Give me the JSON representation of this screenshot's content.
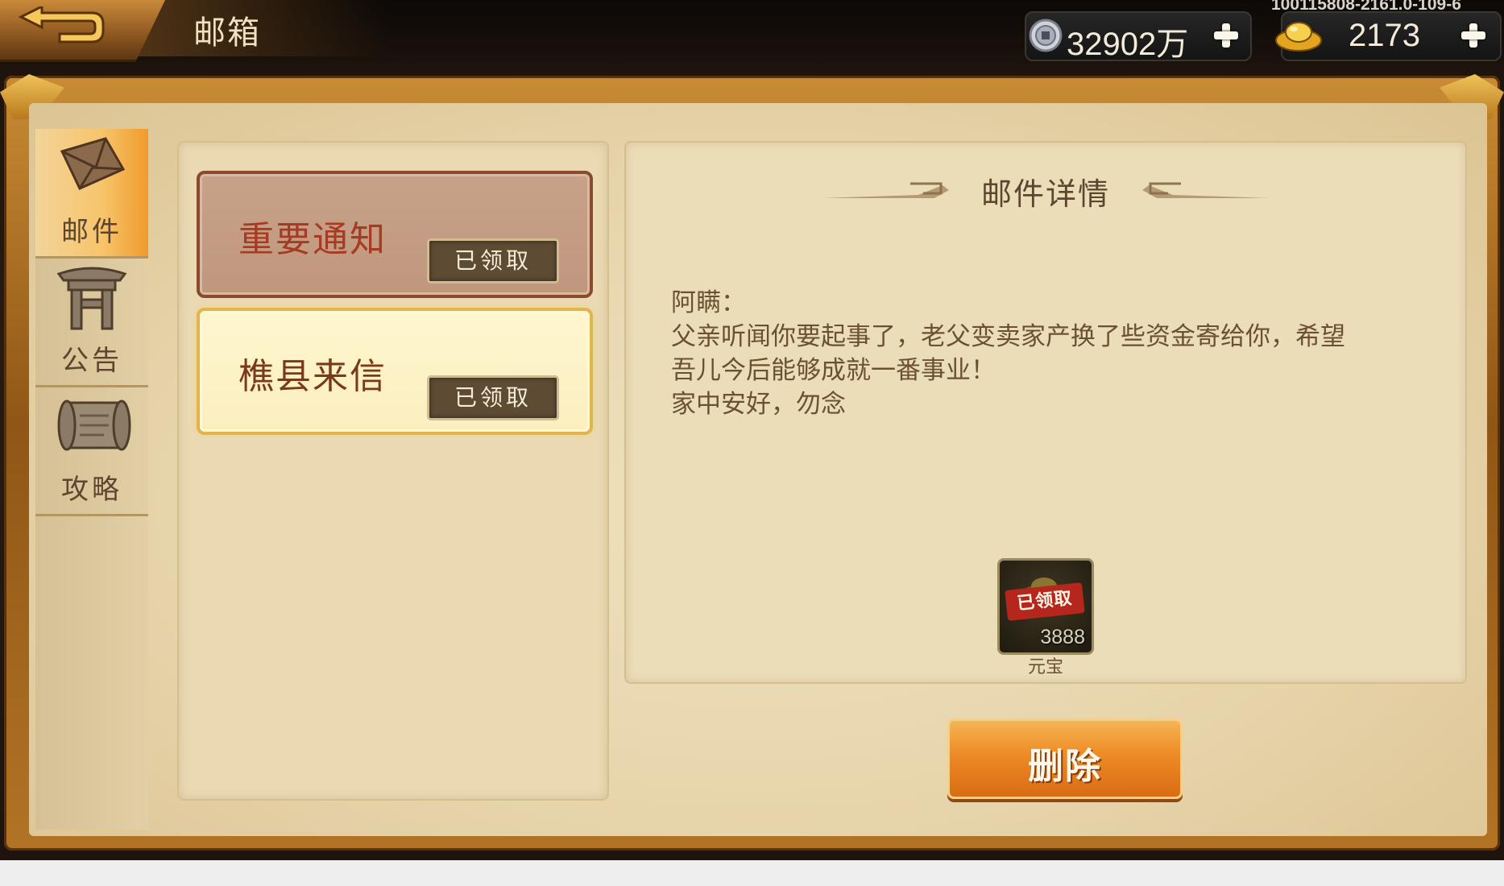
{
  "header": {
    "title": "邮箱",
    "version": "100115808-2161.0-109-6",
    "currencies": [
      {
        "name": "silver-coin",
        "amount": "32902万",
        "icon": "coin-icon"
      },
      {
        "name": "gold-ingot",
        "amount": "2173",
        "icon": "ingot-icon"
      }
    ]
  },
  "sidebar": {
    "tabs": [
      {
        "label": "邮件",
        "icon": "envelope-icon",
        "active": true
      },
      {
        "label": "公告",
        "icon": "gate-icon",
        "active": false
      },
      {
        "label": "攻略",
        "icon": "scroll-icon",
        "active": false
      }
    ]
  },
  "mail_list": [
    {
      "title": "重要通知",
      "status": "已领取",
      "selected": false
    },
    {
      "title": "樵县来信",
      "status": "已领取",
      "selected": true
    }
  ],
  "detail": {
    "heading": "邮件详情",
    "body_lines": [
      "阿瞒：",
      "父亲听闻你要起事了，老父变卖家产换了些资金寄给你，希望",
      "吾儿今后能够成就一番事业！",
      "家中安好，勿念"
    ],
    "attachment": {
      "stamp": "已领取",
      "quantity": "3888",
      "name": "元宝"
    },
    "delete_label": "删除"
  },
  "colors": {
    "frame_gold": "#c98b34",
    "paper": "#ecddb9",
    "delete_orange": "#ed8a25",
    "title_red": "#a63a22"
  }
}
